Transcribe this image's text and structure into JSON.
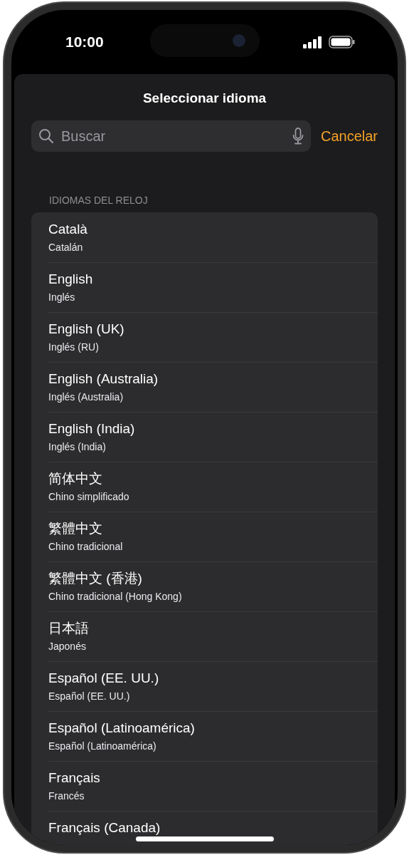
{
  "status_bar": {
    "time": "10:00"
  },
  "sheet": {
    "title": "Seleccionar idioma",
    "search": {
      "placeholder": "Buscar"
    },
    "cancel": "Cancelar"
  },
  "section": {
    "header": "IDIOMAS DEL RELOJ",
    "items": [
      {
        "title": "Català",
        "subtitle": "Catalán"
      },
      {
        "title": "English",
        "subtitle": "Inglés"
      },
      {
        "title": "English (UK)",
        "subtitle": "Inglés (RU)"
      },
      {
        "title": "English (Australia)",
        "subtitle": "Inglés (Australia)"
      },
      {
        "title": "English (India)",
        "subtitle": "Inglés (India)"
      },
      {
        "title": "简体中文",
        "subtitle": "Chino simplificado"
      },
      {
        "title": "繁體中文",
        "subtitle": "Chino tradicional"
      },
      {
        "title": "繁體中文 (香港)",
        "subtitle": "Chino tradicional (Hong Kong)"
      },
      {
        "title": "日本語",
        "subtitle": "Japonés"
      },
      {
        "title": "Español (EE. UU.)",
        "subtitle": "Español (EE. UU.)"
      },
      {
        "title": "Español (Latinoamérica)",
        "subtitle": "Español (Latinoamérica)"
      },
      {
        "title": "Français",
        "subtitle": "Francés"
      },
      {
        "title": "Français (Canada)"
      }
    ]
  }
}
